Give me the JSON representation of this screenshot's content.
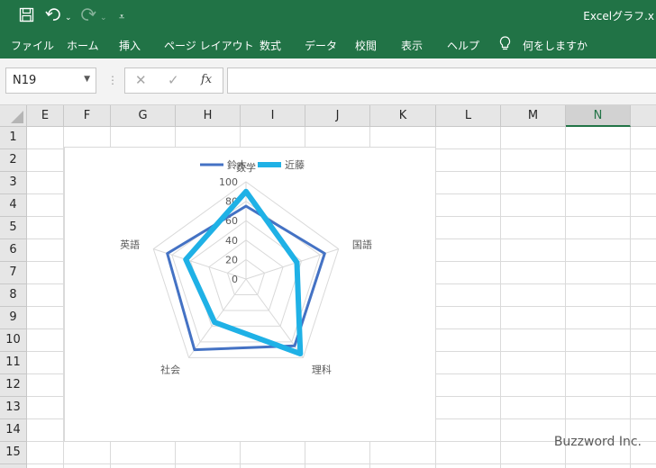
{
  "titlebar": {
    "save_icon": "save-icon",
    "undo_icon": "undo-icon",
    "redo_icon": "redo-icon",
    "customize_icon": "customize-quick-access-icon",
    "title": "Excelグラフ.x"
  },
  "ribbon": {
    "tabs": [
      {
        "label": "ファイル"
      },
      {
        "label": "ホーム"
      },
      {
        "label": "挿入"
      },
      {
        "label": "ページ レイアウト"
      },
      {
        "label": "数式"
      },
      {
        "label": "データ"
      },
      {
        "label": "校閲"
      },
      {
        "label": "表示"
      },
      {
        "label": "ヘルプ"
      }
    ],
    "tell_me_icon": "lightbulb-icon",
    "tell_me": "何をしますか"
  },
  "formula_bar": {
    "name_box": "N19",
    "cancel_icon": "x-icon",
    "enter_icon": "checkmark-icon",
    "function_label": "fx",
    "formula": ""
  },
  "sheet": {
    "columns": [
      "E",
      "F",
      "G",
      "H",
      "I",
      "J",
      "K",
      "L",
      "M",
      "N"
    ],
    "active_column": "N",
    "rows": [
      "1",
      "2",
      "3",
      "4",
      "5",
      "6",
      "7",
      "8",
      "9",
      "10",
      "11",
      "12",
      "13",
      "14",
      "15"
    ]
  },
  "chart_data": {
    "type": "radar",
    "categories": [
      "数学",
      "国語",
      "理科",
      "社会",
      "英語"
    ],
    "series": [
      {
        "name": "鈴木",
        "values": [
          75,
          85,
          85,
          90,
          85
        ],
        "color": "#4472c4"
      },
      {
        "name": "近藤",
        "values": [
          90,
          55,
          95,
          55,
          65
        ],
        "color": "#1fb1e6"
      }
    ],
    "radial_ticks": [
      "0",
      "20",
      "40",
      "60",
      "80",
      "100"
    ],
    "rmin": 0,
    "rmax": 100,
    "legend_position": "top",
    "grid": true
  },
  "watermark": "Buzzword Inc."
}
